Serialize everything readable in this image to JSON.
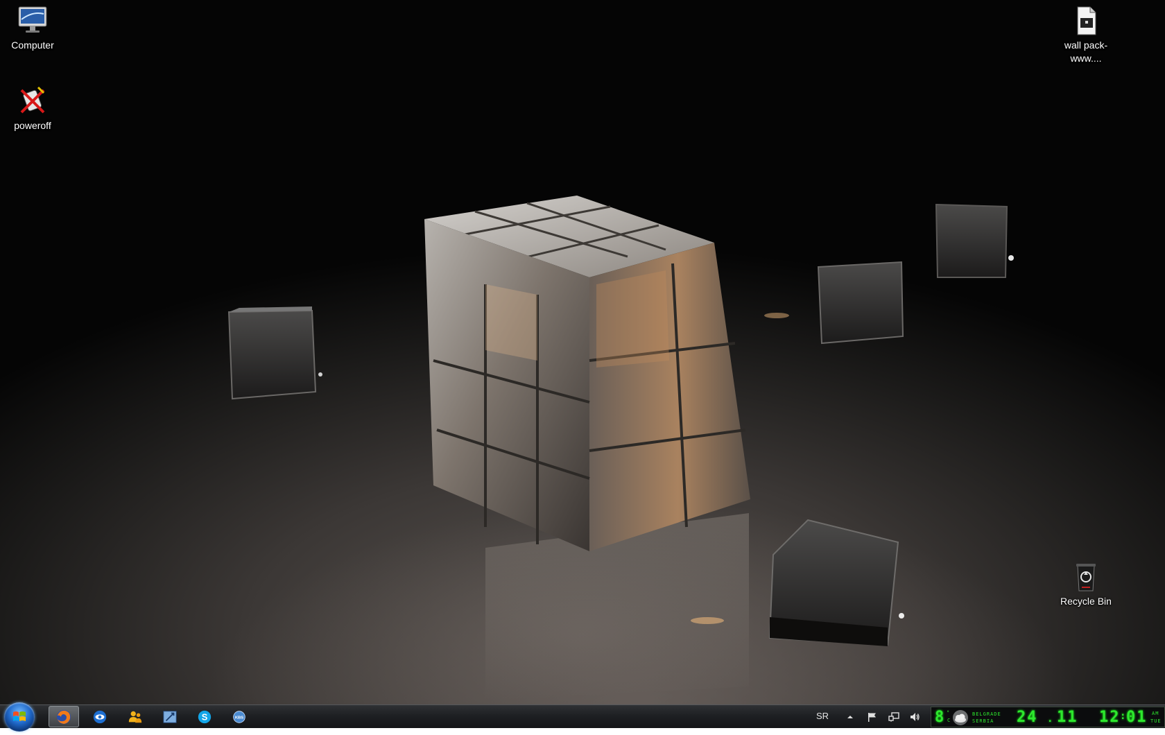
{
  "desktop": {
    "icons": [
      {
        "label": "Computer",
        "icon": "computer-icon"
      },
      {
        "label": "poweroff",
        "icon": "poweroff-icon"
      },
      {
        "label": "wall pack-www....",
        "icon": "file-icon"
      },
      {
        "label": "Recycle Bin",
        "icon": "recycle-bin-icon"
      }
    ]
  },
  "taskbar": {
    "start": {
      "icon": "windows-start-icon"
    },
    "pinned": [
      {
        "icon": "firefox-icon",
        "active": true
      },
      {
        "icon": "teamviewer-icon"
      },
      {
        "icon": "people-icon"
      },
      {
        "icon": "xlauncher-icon"
      },
      {
        "icon": "skype-icon"
      },
      {
        "icon": "kbs-icon",
        "label": "KBS"
      }
    ],
    "tray": {
      "language": "SR",
      "icons": [
        "show-hidden-icons-arrow",
        "action-center-flag-icon",
        "network-icon",
        "volume-icon"
      ]
    },
    "clock": {
      "temperature": "8",
      "temp_unit_top": "°",
      "temp_unit_bottom": "C",
      "city": "BELGRADE",
      "country": "SERBIA",
      "day": "24",
      "month": "11",
      "hour": "12",
      "minute": "01",
      "ampm": "AM",
      "weekday": "TUE"
    }
  },
  "colors": {
    "lcd_green": "#2ee82e",
    "taskbar_bg": "#1e2023"
  }
}
